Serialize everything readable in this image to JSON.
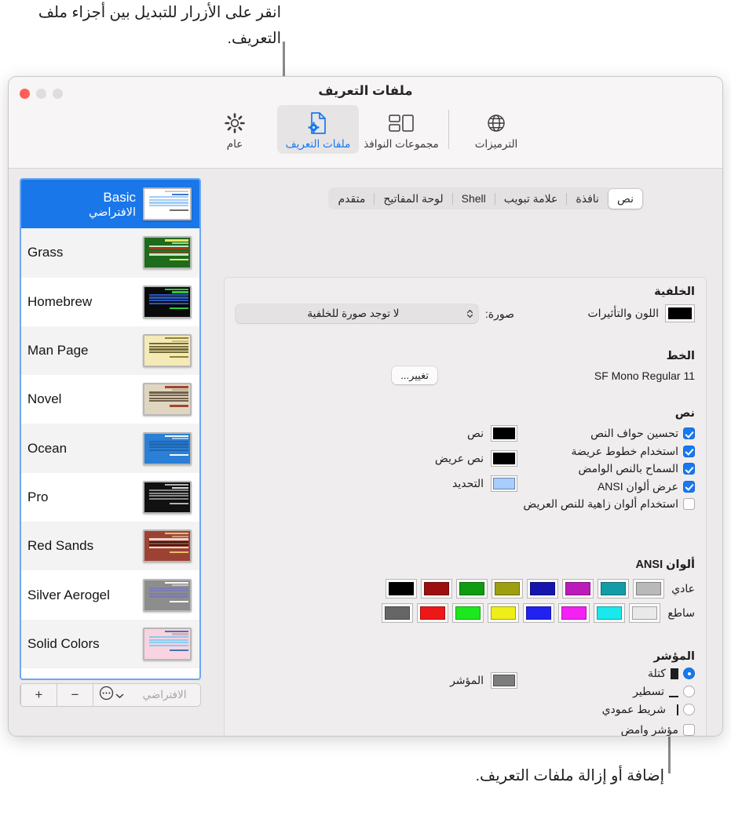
{
  "callouts": {
    "top": "انقر على الأزرار للتبديل بين أجزاء ملف التعريف.",
    "bottom": "إضافة أو إزالة ملفات التعريف."
  },
  "window": {
    "title": "ملفات التعريف",
    "toolbar": [
      {
        "label": "عام",
        "icon": "gear-icon",
        "active": false
      },
      {
        "label": "ملفات التعريف",
        "icon": "profile-document-icon",
        "active": true
      },
      {
        "label": "مجموعات النوافذ",
        "icon": "window-groups-icon",
        "active": false
      },
      {
        "label": "الترميزات",
        "icon": "globe-icon",
        "active": false
      }
    ]
  },
  "segments": [
    {
      "label": "نص",
      "selected": true
    },
    {
      "label": "نافذة",
      "selected": false
    },
    {
      "label": "علامة تبويب",
      "selected": false
    },
    {
      "label": "Shell",
      "selected": false
    },
    {
      "label": "لوحة المفاتيح",
      "selected": false
    },
    {
      "label": "متقدم",
      "selected": false
    }
  ],
  "background": {
    "heading": "الخلفية",
    "color_effects_label": "اللون والتأثيرات",
    "color_well": "#000000",
    "image_label": "صورة:",
    "image_value": "لا توجد صورة للخلفية"
  },
  "font": {
    "heading": "الخط",
    "value": "SF Mono Regular 11",
    "change_button": "تغيير..."
  },
  "text": {
    "heading": "نص",
    "checkboxes": [
      {
        "label": "تحسين حواف النص",
        "checked": true
      },
      {
        "label": "استخدام خطوط عريضة",
        "checked": true
      },
      {
        "label": "السماح بالنص الوامض",
        "checked": true
      },
      {
        "label": "عرض ألوان ANSI",
        "checked": true
      },
      {
        "label": "استخدام ألوان زاهية للنص العريض",
        "checked": false
      }
    ],
    "wells": [
      {
        "label": "نص",
        "color": "#000000"
      },
      {
        "label": "نص عريض",
        "color": "#000000"
      },
      {
        "label": "التحديد",
        "color": "#a7ceff"
      }
    ]
  },
  "ansi": {
    "heading": "ألوان ANSI",
    "normal_label": "عادي",
    "bright_label": "ساطع",
    "normal": [
      "#b9b9b9",
      "#139ca8",
      "#ba1bba",
      "#1515ad",
      "#9e9e11",
      "#0f9c10",
      "#9c0f0f",
      "#000000"
    ],
    "bright": [
      "#e9e9e9",
      "#19e8ec",
      "#f321f3",
      "#2121f0",
      "#eeee18",
      "#1de81d",
      "#ee1717",
      "#666666"
    ]
  },
  "cursor": {
    "heading": "المؤشر",
    "options": [
      {
        "label": "كتلة",
        "glyph": "block",
        "selected": true
      },
      {
        "label": "تسطير",
        "glyph": "underline",
        "selected": false
      },
      {
        "label": "شريط عمودي",
        "glyph": "bar",
        "selected": false
      }
    ],
    "blink_label": "مؤشر وامض",
    "blink_checked": false,
    "well_label": "المؤشر",
    "well_color": "#7d7d7d"
  },
  "help_button": "؟",
  "profiles": [
    {
      "name": "Basic",
      "subtitle": "الافتراضي",
      "selected": true,
      "thumb": {
        "bg": "#ffffff",
        "title": "#cfcfcf",
        "text": "#333333",
        "hl": "#9cc9f5",
        "accent": "#2f6fd0"
      }
    },
    {
      "name": "Grass",
      "subtitle": "",
      "selected": false,
      "thumb": {
        "bg": "#1d6b1b",
        "title": "#9be39b",
        "text": "#ccf0cc",
        "hl": "#a8361f",
        "accent": "#f3e96a"
      }
    },
    {
      "name": "Homebrew",
      "subtitle": "",
      "selected": false,
      "thumb": {
        "bg": "#0a0a0a",
        "title": "#35d435",
        "text": "#35d435",
        "hl": "#2b5cc4",
        "accent": "#35d435"
      }
    },
    {
      "name": "Man Page",
      "subtitle": "",
      "selected": false,
      "thumb": {
        "bg": "#f3eab6",
        "title": "#c9bd77",
        "text": "#4a4322",
        "hl": "#d8cd8c",
        "accent": "#8a7b2d"
      }
    },
    {
      "name": "Novel",
      "subtitle": "",
      "selected": false,
      "thumb": {
        "bg": "#e0d6c0",
        "title": "#b9ad90",
        "text": "#5b4a33",
        "hl": "#c4b795",
        "accent": "#9e3b2a"
      }
    },
    {
      "name": "Ocean",
      "subtitle": "",
      "selected": false,
      "thumb": {
        "bg": "#2b7fd6",
        "title": "#9fcdf3",
        "text": "#eaf4ff",
        "hl": "#1f65ad",
        "accent": "#ffffff"
      }
    },
    {
      "name": "Pro",
      "subtitle": "",
      "selected": false,
      "thumb": {
        "bg": "#111111",
        "title": "#555555",
        "text": "#dcdcdc",
        "hl": "#3a3a3a",
        "accent": "#bdbdbd"
      }
    },
    {
      "name": "Red Sands",
      "subtitle": "",
      "selected": false,
      "thumb": {
        "bg": "#9c4233",
        "title": "#d89a86",
        "text": "#f2ddd3",
        "hl": "#6f2a1e",
        "accent": "#f0c56a"
      }
    },
    {
      "name": "Silver Aerogel",
      "subtitle": "",
      "selected": false,
      "thumb": {
        "bg": "#8d8d8d",
        "title": "#c6c6c6",
        "text": "#f2f2f2",
        "hl": "#7a7ab4",
        "accent": "#ffffff"
      }
    },
    {
      "name": "Solid Colors",
      "subtitle": "",
      "selected": false,
      "thumb": {
        "bg": "#f7d4e0",
        "title": "#d9a8bc",
        "text": "#5a3545",
        "hl": "#86c9ee",
        "accent": "#3c6fa8"
      }
    }
  ],
  "list_tools": {
    "add": "+",
    "remove": "−",
    "more": "•••",
    "default_button": "الافتراضي"
  }
}
